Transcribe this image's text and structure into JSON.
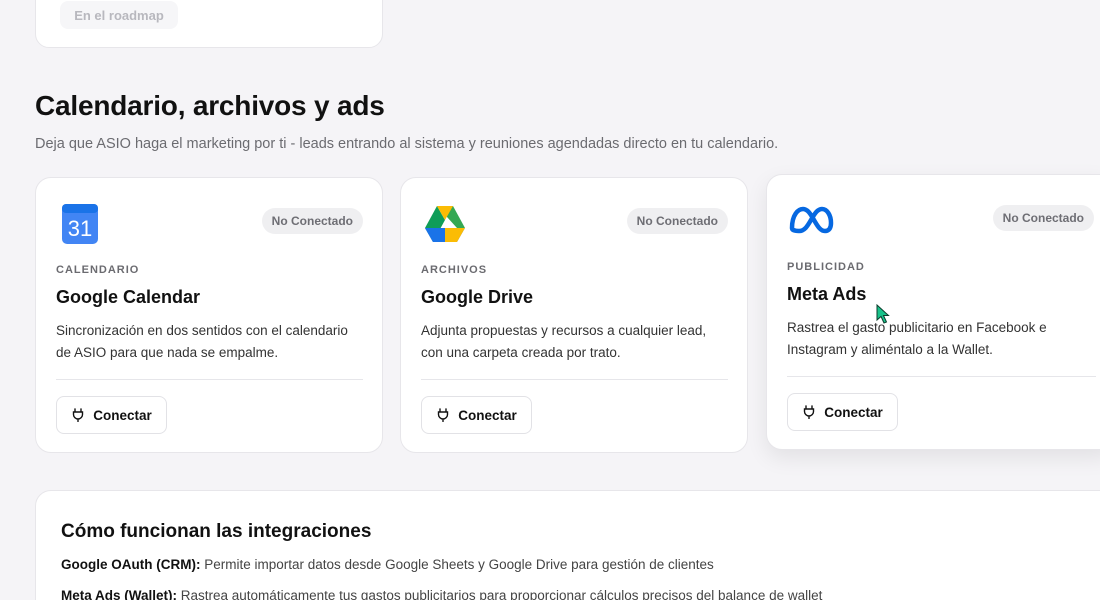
{
  "top_card": {
    "roadmap_label": "En el roadmap"
  },
  "section": {
    "title": "Calendario, archivos y ads",
    "subtitle": "Deja que ASIO haga el marketing por ti - leads entrando al sistema y reuniones agendadas directo en tu calendario."
  },
  "cards": [
    {
      "icon": "google-calendar-icon",
      "calendar_day": "31",
      "status": "No Conectado",
      "category": "CALENDARIO",
      "title": "Google Calendar",
      "description": "Sincronización en dos sentidos con el calendario de ASIO para que nada se empalme.",
      "button": "Conectar"
    },
    {
      "icon": "google-drive-icon",
      "status": "No Conectado",
      "category": "ARCHIVOS",
      "title": "Google Drive",
      "description": "Adjunta propuestas y recursos a cualquier lead, con una carpeta creada por trato.",
      "button": "Conectar"
    },
    {
      "icon": "meta-icon",
      "status": "No Conectado",
      "category": "PUBLICIDAD",
      "title": "Meta Ads",
      "description": "Rastrea el gasto publicitario en Facebook e Instagram y aliméntalo a la Wallet.",
      "button": "Conectar"
    }
  ],
  "info": {
    "title": "Cómo funcionan las integraciones",
    "lines": [
      {
        "label": "Google OAuth (CRM):",
        "text": " Permite importar datos desde Google Sheets y Google Drive para gestión de clientes"
      },
      {
        "label": "Meta Ads (Wallet):",
        "text": " Rastrea automáticamente tus gastos publicitarios para proporcionar cálculos precisos del balance de wallet"
      }
    ]
  },
  "colors": {
    "background": "#f5f4f7",
    "status_pill": "#efeff1",
    "google_blue": "#4285f4",
    "meta_blue": "#0668e1"
  }
}
